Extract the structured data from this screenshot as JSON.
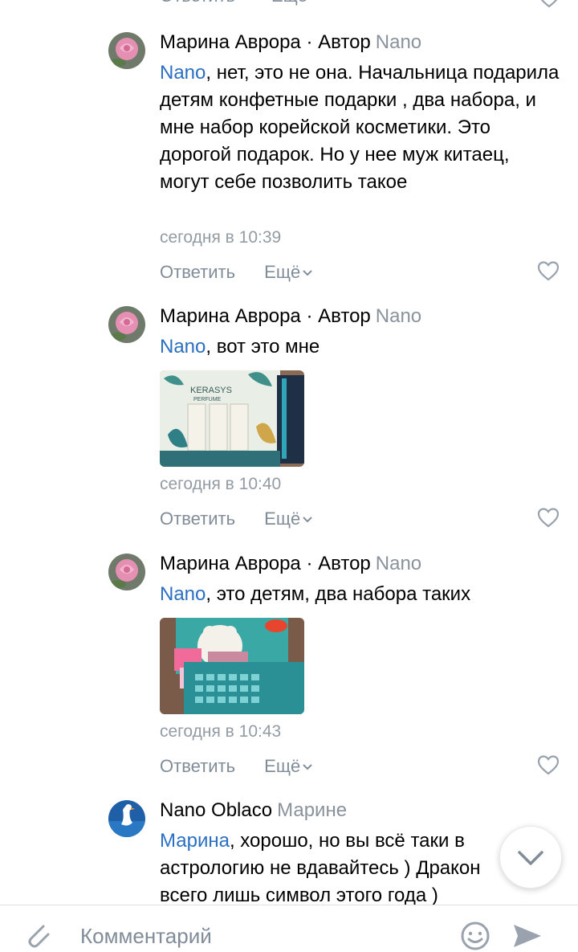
{
  "top_strip": {
    "reply_label": "Ответить",
    "more_label": "Ещё"
  },
  "comments": [
    {
      "author": "Марина Аврора · Автор",
      "reply_to": "Nano",
      "mention": "Nano",
      "text": ", нет, это не она. Начальница подарила детям конфетные подарки , два набора, и мне набор корейской косметики. Это дорогой подарок. Но у нее муж китаец, могут себе позволить такое",
      "time": "сегодня в 10:39",
      "reply_label": "Ответить",
      "more_label": "Ещё"
    },
    {
      "author": "Марина Аврора · Автор",
      "reply_to": "Nano",
      "mention": "Nano",
      "text": ", вот это мне",
      "photo_brand": "KERASYS",
      "photo_sub": "PERFUME",
      "time": "сегодня в 10:40",
      "reply_label": "Ответить",
      "more_label": "Ещё"
    },
    {
      "author": "Марина Аврора · Автор",
      "reply_to": "Nano",
      "mention": "Nano",
      "text": ", это детям, два набора таких",
      "time": "сегодня в 10:43",
      "reply_label": "Ответить",
      "more_label": "Ещё"
    },
    {
      "author": "Nano Oblaco",
      "reply_to": "Марине",
      "mention": "Марина",
      "text": ", хорошо, но вы всё таки в астрологию не вдавайтесь ) Дракон всего лишь символ этого года )"
    }
  ],
  "composer": {
    "placeholder": "Комментарий"
  },
  "colors": {
    "link": "#2a6fc2",
    "secondary": "#818c99",
    "time": "#939ba3",
    "icon": "#99a2ad"
  }
}
